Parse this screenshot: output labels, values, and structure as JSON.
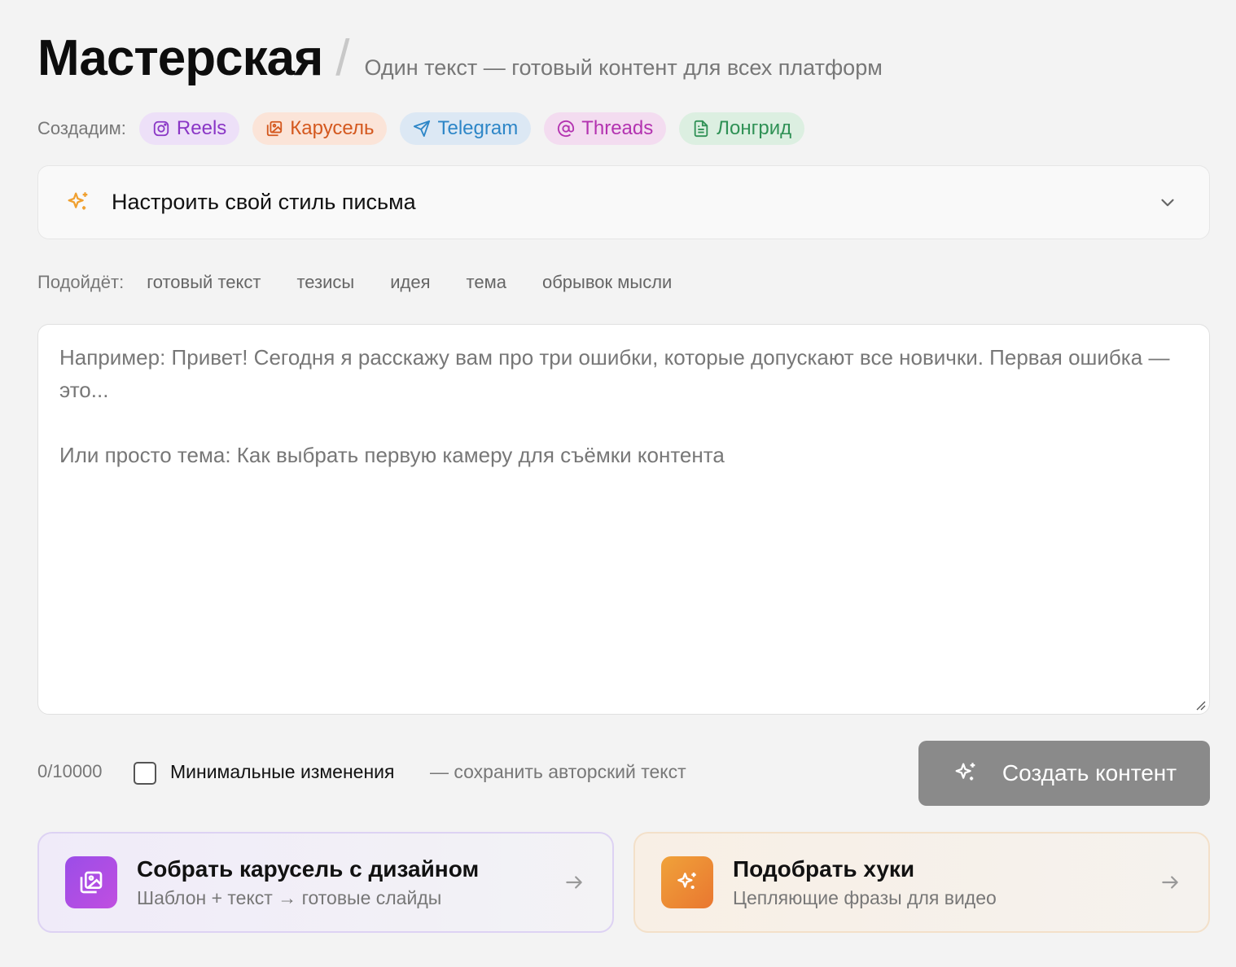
{
  "header": {
    "title": "Мастерская",
    "separator": "/",
    "subtitle": "Один текст — готовый контент для всех платформ"
  },
  "platforms": {
    "label": "Создадим:",
    "items": [
      {
        "label": "Reels",
        "icon": "instagram-icon",
        "color": "#8a36c6"
      },
      {
        "label": "Карусель",
        "icon": "carousel-icon",
        "color": "#d4581e"
      },
      {
        "label": "Telegram",
        "icon": "telegram-icon",
        "color": "#2d86c7"
      },
      {
        "label": "Threads",
        "icon": "threads-icon",
        "color": "#b332b0"
      },
      {
        "label": "Лонгрид",
        "icon": "document-icon",
        "color": "#2f9155"
      }
    ]
  },
  "style_panel": {
    "label": "Настроить свой стиль письма",
    "icon": "sparkle-icon",
    "expanded": false
  },
  "suitable": {
    "label": "Подойдёт:",
    "items": [
      "готовый текст",
      "тезисы",
      "идея",
      "тема",
      "обрывок мысли"
    ]
  },
  "editor": {
    "value": "",
    "placeholder": "Например: Привет! Сегодня я расскажу вам про три ошибки, которые допускают все новички. Первая ошибка — это...\n\nИли просто тема: Как выбрать первую камеру для съёмки контента"
  },
  "controls": {
    "counter": "0/10000",
    "minimal_changes_label": "Минимальные изменения",
    "minimal_changes_hint": "— сохранить авторский текст",
    "minimal_changes_checked": false,
    "create_button": "Создать контент"
  },
  "cards": [
    {
      "title": "Собрать карусель с дизайном",
      "subtitle": "Шаблон + текст → готовые слайды",
      "icon": "carousel-icon",
      "accent": "#a64ee6"
    },
    {
      "title": "Подобрать хуки",
      "subtitle": "Цепляющие фразы для видео",
      "icon": "sparkle-icon",
      "accent": "#ec8a33"
    }
  ]
}
